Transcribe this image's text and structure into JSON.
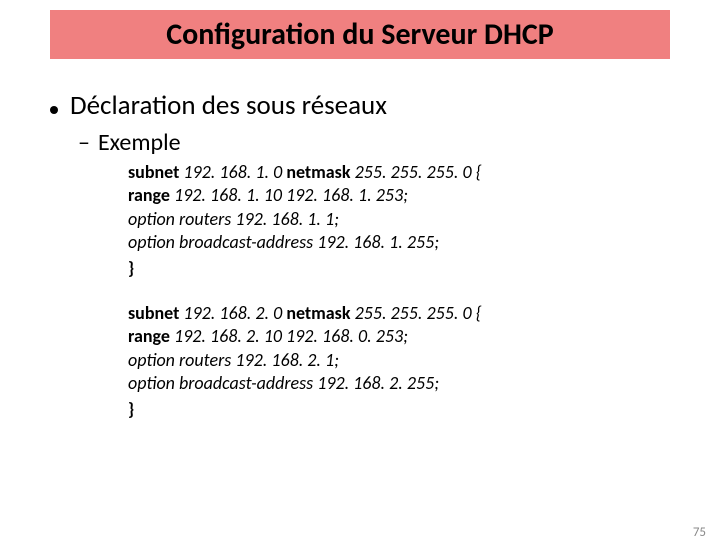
{
  "title": "Configuration du Serveur DHCP",
  "bullet": "Déclaration des sous réseaux",
  "sub": "Exemple",
  "block1": {
    "l1a": "subnet",
    "l1b": " 192. 168. 1. 0 ",
    "l1c": "netmask",
    "l1d": " 255. 255. 255. 0 {",
    "l2a": "range",
    "l2b": "   192. 168. 1. 10     192. 168. 1. 253;",
    "l3": "option routers 192. 168. 1. 1;",
    "l4": "option broadcast-address 192. 168. 1. 255;",
    "l5": "}"
  },
  "block2": {
    "l1a": "subnet",
    "l1b": " 192. 168. 2. 0 ",
    "l1c": "netmask",
    "l1d": " 255. 255. 255. 0 {",
    "l2a": " range",
    "l2b": "   192. 168. 2. 10    192. 168. 0. 253;",
    "l3": "option routers 192. 168. 2. 1;",
    "l4": "option broadcast-address 192. 168. 2. 255;",
    "l5": " }"
  },
  "pageNumber": "75"
}
